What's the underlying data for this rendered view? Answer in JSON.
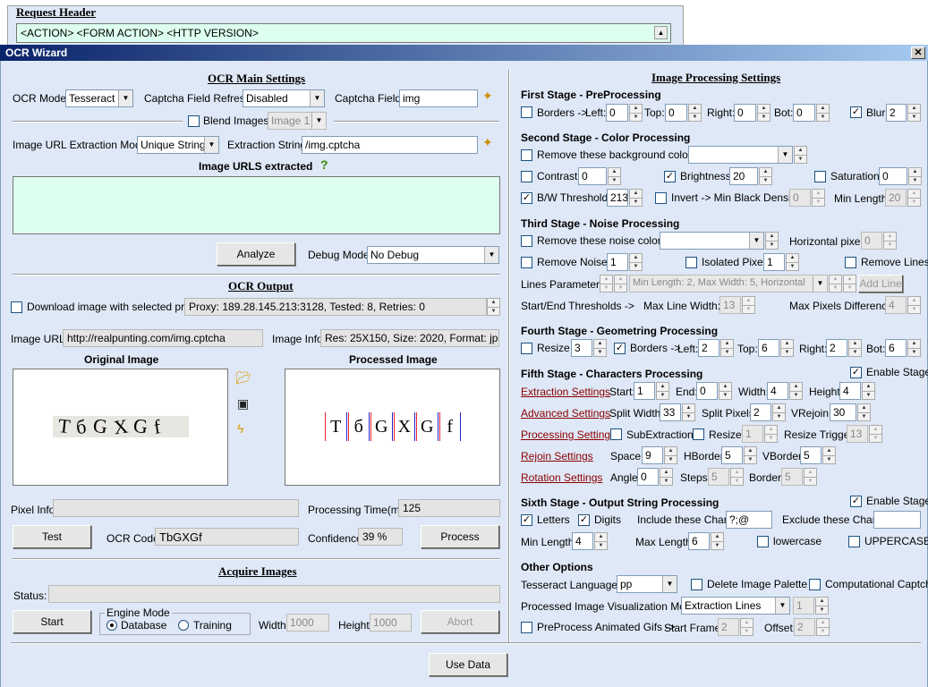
{
  "bg": {
    "header": "Request Header",
    "line": "<ACTION> <FORM ACTION> <HTTP VERSION>"
  },
  "window": {
    "title": "OCR Wizard",
    "close": "✕"
  },
  "main": {
    "heading": "OCR Main Settings",
    "ocr_mode_label": "OCR Mode:",
    "ocr_mode": "Tesseract",
    "refresh_label": "Captcha Field Refresh:",
    "refresh": "Disabled",
    "field_label": "Captcha Field:",
    "field": "img",
    "blend_label": "Blend Images:",
    "blend": "Image 1",
    "url_mode_label": "Image URL Extraction Mode:",
    "url_mode": "Unique String",
    "ext_label": "Extraction String:",
    "ext": "/img.cptcha",
    "urls_label": "Image URLS extracted",
    "analyze": "Analyze",
    "debug_label": "Debug Mode:",
    "debug": "No Debug"
  },
  "output": {
    "heading": "OCR Output",
    "proxy_label": "Download image with selected proxy:",
    "proxy": "Proxy: 189.28.145.213:3128, Tested: 8, Retries: 0",
    "url_label": "Image URL:",
    "url": "http://realpunting.com/img.cptcha",
    "info_label": "Image Info:",
    "info": "Res: 25X150, Size: 2020, Format: jpg",
    "orig": "Original Image",
    "proc": "Processed Image",
    "captcha_text": "TbGXGf",
    "captcha_glyphs": [
      "T",
      "б",
      "G",
      "X",
      "G",
      "f"
    ],
    "pixel_label": "Pixel Info:",
    "time_label": "Processing Time(ms):",
    "time": "125",
    "test": "Test",
    "code_label": "OCR Code:",
    "code": "TbGXGf",
    "conf_label": "Confidence:",
    "conf": "39 %",
    "process": "Process"
  },
  "acquire": {
    "heading": "Acquire Images",
    "status_label": "Status:",
    "start": "Start",
    "engine": "Engine Mode",
    "database": "Database",
    "training": "Training",
    "width_label": "Width:",
    "width": "1000",
    "height_label": "Height:",
    "height": "1000",
    "abort": "Abort"
  },
  "ips": {
    "heading": "Image Processing Settings",
    "s1": {
      "title": "First Stage - PreProcessing",
      "borders": "Borders ->",
      "left": "Left:",
      "top": "Top:",
      "right": "Right:",
      "bot": "Bot:",
      "lv": "0",
      "tv": "0",
      "rv": "0",
      "bv": "0",
      "blur": "Blur",
      "blurv": "2"
    },
    "s2": {
      "title": "Second Stage - Color Processing",
      "remove_bg": "Remove these background colors:",
      "contrast": "Contrast",
      "contrastv": "0",
      "brightness": "Brightness",
      "brightnessv": "20",
      "saturation": "Saturation",
      "saturationv": "0",
      "bw": "B/W Threshold",
      "bwv": "213",
      "invert": "Invert -> Min Black Density:",
      "invertv": "0",
      "minlen": "Min Length:",
      "minlenv": "20"
    },
    "s3": {
      "title": "Third Stage - Noise Processing",
      "remove_noise_colors": "Remove these noise colors:",
      "hpix": "Horizontal pixels:",
      "hpixv": "0",
      "remove_noise": "Remove Noise",
      "noisev": "1",
      "isolated": "Isolated Pixels",
      "isolatedv": "1",
      "remove_lines": "Remove Lines",
      "lines_params": "Lines Parameters:",
      "lines_sel": "Min Length: 2, Max Width: 5, Horizontal",
      "add_line": "Add Line",
      "thresholds": "Start/End Thresholds ->",
      "maxline": "Max Line Width:",
      "maxlinev": "13",
      "maxpix": "Max Pixels Difference:",
      "maxpixv": "4"
    },
    "s4": {
      "title": "Fourth Stage - Geometring Processing",
      "resize": "Resize",
      "resizev": "3",
      "borders": "Borders ->",
      "left": "Left:",
      "lv": "2",
      "top": "Top:",
      "tv": "6",
      "right": "Right:",
      "rv": "2",
      "bot": "Bot:",
      "bv": "6"
    },
    "s5": {
      "title": "Fifth Stage - Characters Processing",
      "enable": "Enable Stage",
      "ext_link": "Extraction Settings",
      "adv_link": "Advanced Settings",
      "proc_link": "Processing Settings",
      "rejoin_link": "Rejoin Settings",
      "rot_link": "Rotation Settings",
      "start": "Start:",
      "startv": "1",
      "end": "End:",
      "endv": "0",
      "width": "Width:",
      "widthv": "4",
      "height": "Height:",
      "heightv": "4",
      "split_w": "Split Width:",
      "split_wv": "33",
      "split_p": "Split Pixels:",
      "split_pv": "2",
      "vrejoin": "VRejoin:",
      "vrejoinv": "30",
      "subext": "SubExtraction",
      "resize": "Resize:",
      "resizev": "1",
      "resize_trig": "Resize Trigger:",
      "resize_trigv": "13",
      "space": "Space:",
      "spacev": "9",
      "hborder": "HBorder:",
      "hborderv": "5",
      "vborder": "VBorder:",
      "vborderv": "5",
      "angle": "Angle:",
      "anglev": "0",
      "steps": "Steps:",
      "stepsv": "5",
      "border": "Border:",
      "borderv": "5"
    },
    "s6": {
      "title": "Sixth Stage - Output String Processing",
      "enable": "Enable Stage",
      "letters": "Letters",
      "digits": "Digits",
      "include": "Include these Chars:",
      "includev": "?;@",
      "exclude": "Exclude these Chars:",
      "minlen": "Min Length:",
      "minlenv": "4",
      "maxlen": "Max Length:",
      "maxlenv": "6",
      "lower": "lowercase",
      "upper": "UPPERCASE"
    },
    "other": {
      "title": "Other Options",
      "tess_lang": "Tesseract Language:",
      "tess_langv": "pp",
      "delete_palette": "Delete Image Palette",
      "computational": "Computational Captcha",
      "vis_mode": "Processed Image Visualization Mode:",
      "vis_modev": "Extraction Lines",
      "vis_num": "1",
      "preprocess": "PreProcess Animated Gifs ->",
      "start_frame": "Start Frame:",
      "start_framev": "2",
      "offset": "Offset:",
      "offsetv": "2"
    }
  },
  "use_data": "Use Data"
}
